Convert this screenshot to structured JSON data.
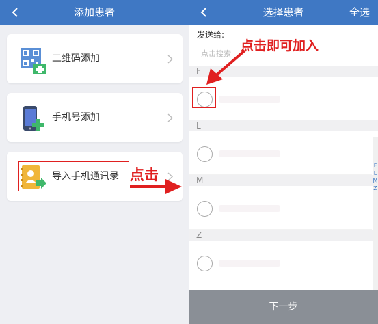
{
  "left": {
    "nav": {
      "title": "添加患者"
    },
    "cards": [
      {
        "label": "二维码添加",
        "icon": "qr-code-add-icon"
      },
      {
        "label": "手机号添加",
        "icon": "phone-add-icon"
      },
      {
        "label": "导入手机通讯录",
        "icon": "contacts-import-icon"
      }
    ],
    "annotation": "点击"
  },
  "right": {
    "nav": {
      "title": "选择患者",
      "select_all": "全选"
    },
    "send_to_label": "发送给:",
    "search_placeholder": "点击搜索",
    "sections": [
      {
        "letter": "F"
      },
      {
        "letter": "L"
      },
      {
        "letter": "M"
      },
      {
        "letter": "Z"
      }
    ],
    "index_letters": [
      "F",
      "L",
      "M",
      "Z"
    ],
    "annotation": "点击即可加入",
    "next_button": "下一步"
  },
  "colors": {
    "nav_bg": "#3f78c4",
    "annotation": "#e02020",
    "bottom_button": "#8a8f96"
  }
}
